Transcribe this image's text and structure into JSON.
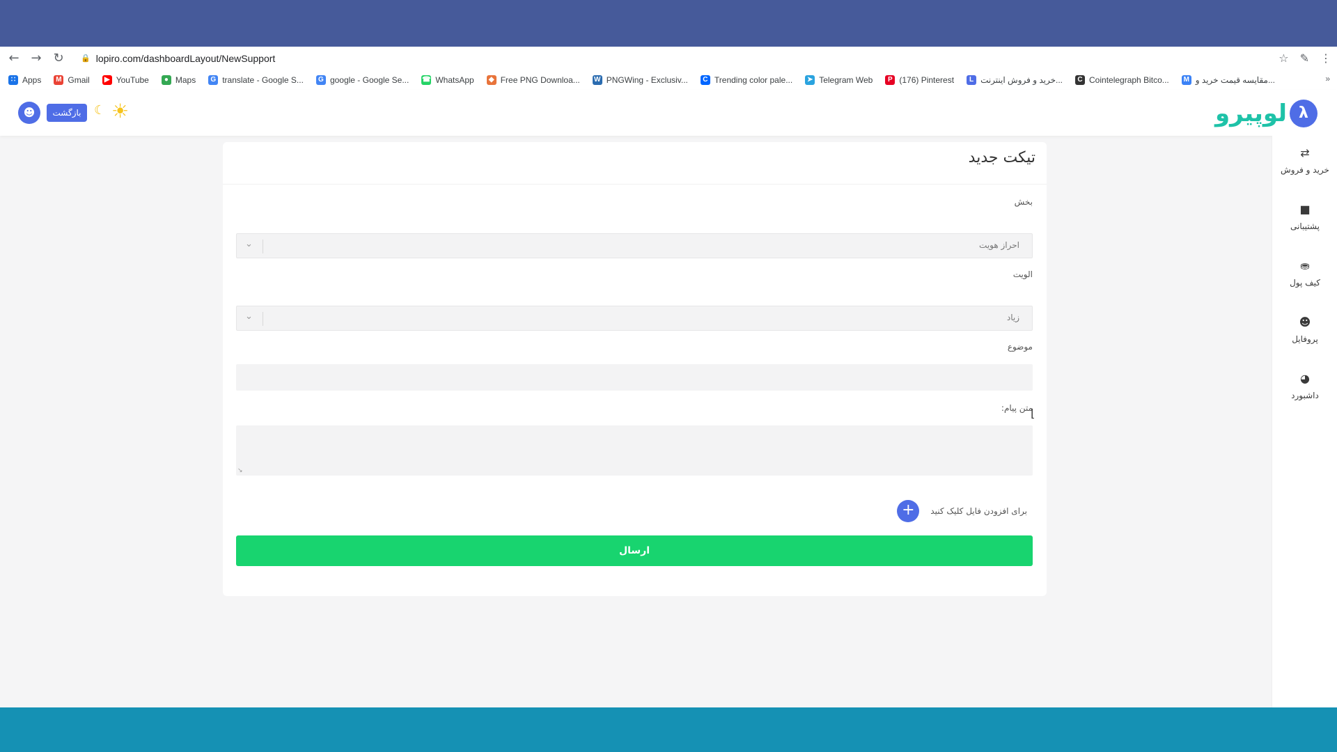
{
  "browser": {
    "url": "lopiro.com/dashboardLayout/NewSupport",
    "bookmarks": [
      {
        "label": "Apps",
        "icon": "apps-grid-icon",
        "color": "#1a73e8"
      },
      {
        "label": "Gmail",
        "icon": "gmail-icon",
        "color": "#ea4335"
      },
      {
        "label": "YouTube",
        "icon": "youtube-icon",
        "color": "#ff0000"
      },
      {
        "label": "Maps",
        "icon": "maps-icon",
        "color": "#34a853"
      },
      {
        "label": "translate - Google S...",
        "icon": "google-icon",
        "color": "#4285f4"
      },
      {
        "label": "google - Google Se...",
        "icon": "google-icon",
        "color": "#4285f4"
      },
      {
        "label": "WhatsApp",
        "icon": "whatsapp-icon",
        "color": "#25d366"
      },
      {
        "label": "Free PNG Downloa...",
        "icon": "pngtree-icon",
        "color": "#e8743b"
      },
      {
        "label": "PNGWing - Exclusiv...",
        "icon": "pngwing-icon",
        "color": "#2b6cb0"
      },
      {
        "label": "Trending color pale...",
        "icon": "coolors-icon",
        "color": "#0066ff"
      },
      {
        "label": "Telegram Web",
        "icon": "telegram-icon",
        "color": "#2aa3df"
      },
      {
        "label": "(176) Pinterest",
        "icon": "pinterest-icon",
        "color": "#e60023"
      },
      {
        "label": "خرید و فروش اینترنت...",
        "icon": "site-icon",
        "color": "#4f6de6"
      },
      {
        "label": "Cointelegraph Bitco...",
        "icon": "cointelegraph-icon",
        "color": "#333333"
      },
      {
        "label": "مقایسه قیمت خرید و...",
        "icon": "mb-icon",
        "color": "#3b82f6"
      }
    ]
  },
  "header": {
    "back_label": "بازگشت",
    "logo_text": "لوپیرو"
  },
  "sidebar": {
    "items": [
      {
        "label": "خرید و فروش",
        "icon": "exchange-icon"
      },
      {
        "label": "پشتیبانی",
        "icon": "chat-icon"
      },
      {
        "label": "کیف پول",
        "icon": "wallet-icon"
      },
      {
        "label": "پروفایل",
        "icon": "profile-icon"
      },
      {
        "label": "داشبورد",
        "icon": "dashboard-icon"
      }
    ]
  },
  "form": {
    "title": "تیکت جدید",
    "section_label": "بخش",
    "section_value": "احراز هویت",
    "priority_label": "الویت",
    "priority_value": "زیاد",
    "subject_label": "موضوع",
    "message_label": "متن پیام:",
    "attach_label": "برای افزودن فایل کلیک کنید",
    "submit_label": "ارسال"
  },
  "colors": {
    "accent": "#4f6de6",
    "submit": "#18d46f",
    "top_band": "#465a9a",
    "bottom_band": "#1591b4"
  }
}
